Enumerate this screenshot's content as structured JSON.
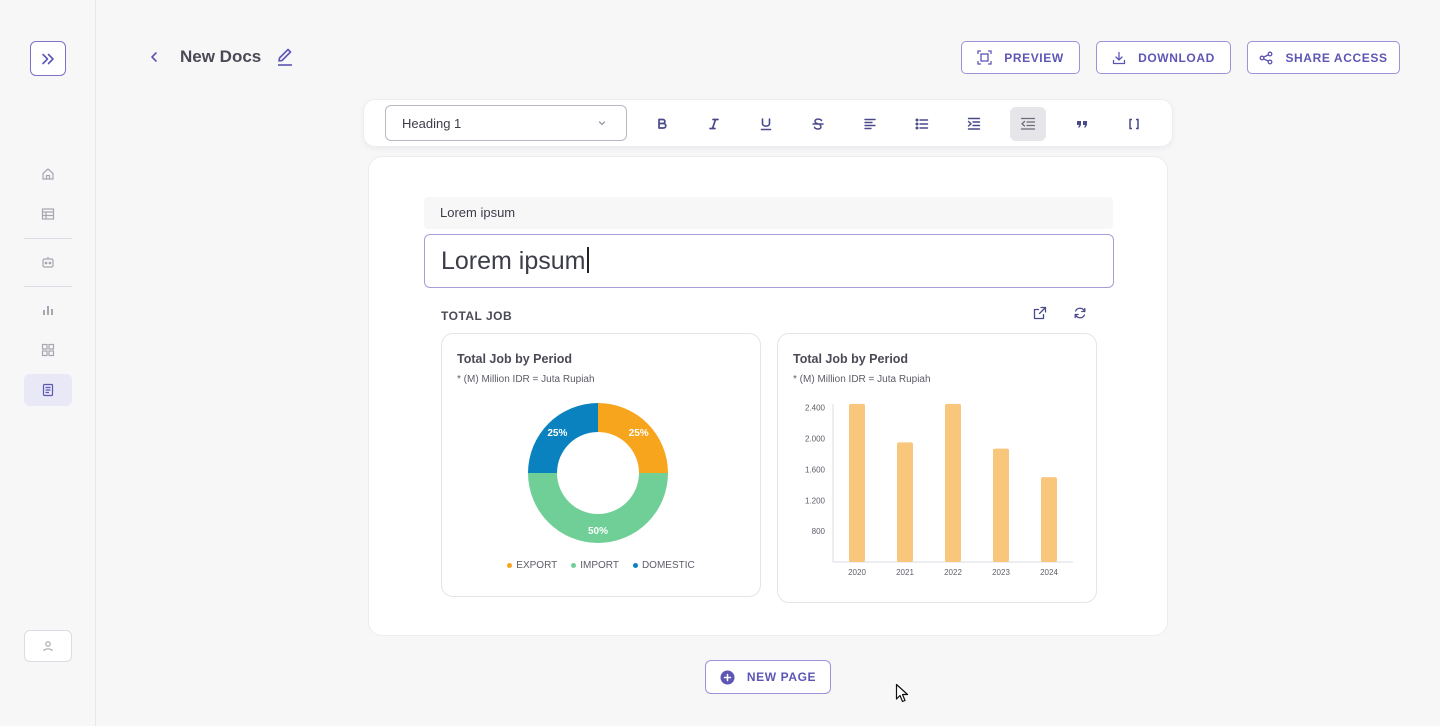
{
  "header": {
    "doc_title": "New Docs",
    "buttons": [
      {
        "label": "PREVIEW",
        "icon": "preview-icon"
      },
      {
        "label": "DOWNLOAD",
        "icon": "download-icon"
      },
      {
        "label": "SHARE ACCESS",
        "icon": "share-icon"
      }
    ]
  },
  "sidebar": {
    "items": [
      "home-icon",
      "table-icon",
      "robot-icon",
      "bar-chart-icon",
      "dashboard-icon",
      "document-icon"
    ],
    "active": "document-icon"
  },
  "toolbar": {
    "format_value": "Heading 1",
    "buttons": [
      "bold-icon",
      "italic-icon",
      "underline-icon",
      "strikethrough-icon",
      "align-left-icon",
      "bullet-list-icon",
      "indent-icon",
      "outdent-icon",
      "quote-icon",
      "code-block-icon"
    ],
    "active": "outdent-icon"
  },
  "editor": {
    "subtitle": "Lorem ipsum",
    "heading": "Lorem ipsum",
    "section_label": "TOTAL JOB"
  },
  "colors": {
    "accent": "#5e56b5",
    "export": "#f8a51e",
    "import": "#6fcf97",
    "domestic": "#0a82c0",
    "bar": "#f9c77c"
  },
  "chart_data": [
    {
      "type": "pie",
      "title": "Total Job by Period",
      "subtitle": "* (M) Million IDR = Juta Rupiah",
      "slices": [
        {
          "label": "EXPORT",
          "value": 25,
          "display": "25%",
          "color": "#f8a51e"
        },
        {
          "label": "IMPORT",
          "value": 50,
          "display": "50%",
          "color": "#6fcf97"
        },
        {
          "label": "DOMESTIC",
          "value": 25,
          "display": "25%",
          "color": "#0a82c0"
        }
      ],
      "legend_placement": "bottom"
    },
    {
      "type": "bar",
      "title": "Total Job by Period",
      "subtitle": "* (M) Million IDR = Juta Rupiah",
      "categories": [
        "2020",
        "2021",
        "2022",
        "2023",
        "2024"
      ],
      "values": [
        2450,
        1950,
        2450,
        1870,
        1500
      ],
      "yticks": [
        "800",
        "1.200",
        "1.600",
        "2.000",
        "2.400"
      ],
      "ytick_values": [
        800,
        1200,
        1600,
        2000,
        2400
      ],
      "ylim": [
        400,
        2500
      ],
      "grid": false
    }
  ],
  "new_page_label": "NEW PAGE"
}
